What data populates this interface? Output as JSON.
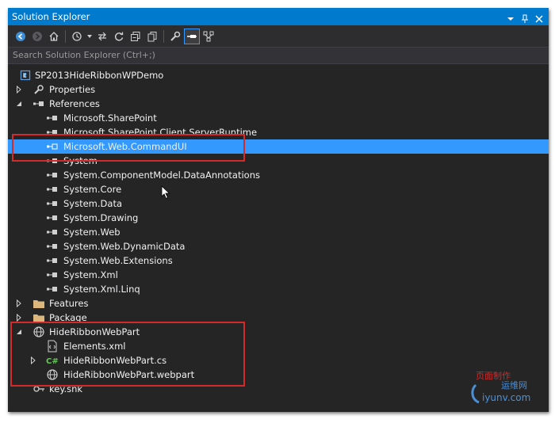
{
  "window": {
    "title": "Solution Explorer"
  },
  "toolbar": {
    "icons": [
      "back-icon",
      "forward-icon",
      "home-icon",
      "history-icon",
      "dropdown-icon",
      "sync-icon",
      "refresh-icon",
      "collapse-all-icon",
      "copy-icon",
      "properties-icon",
      "pin-icon",
      "view-icon"
    ]
  },
  "search": {
    "placeholder": "Search Solution Explorer (Ctrl+;)"
  },
  "tree": {
    "project": "SP2013HideRibbonWPDemo",
    "properties": "Properties",
    "references": "References",
    "ref_items": [
      "Microsoft.SharePoint",
      "Microsoft.SharePoint.Client.ServerRuntime",
      "Microsoft.Web.CommandUI",
      "System",
      "System.ComponentModel.DataAnnotations",
      "System.Core",
      "System.Data",
      "System.Drawing",
      "System.Web",
      "System.Web.DynamicData",
      "System.Web.Extensions",
      "System.Xml",
      "System.Xml.Linq"
    ],
    "features": "Features",
    "package": "Package",
    "webpart": "HideRibbonWebPart",
    "webpart_children": [
      "Elements.xml",
      "HideRibbonWebPart.cs",
      "HideRibbonWebPart.webpart"
    ],
    "keyfile": "key.snk"
  },
  "colors": {
    "selection": "#3399ff",
    "titlebar": "#007acc",
    "background": "#252526",
    "highlight_box": "#d42a2a"
  },
  "watermark": {
    "line1": "页面制作",
    "line2": "运维网",
    "line3": "iyunv.com"
  }
}
